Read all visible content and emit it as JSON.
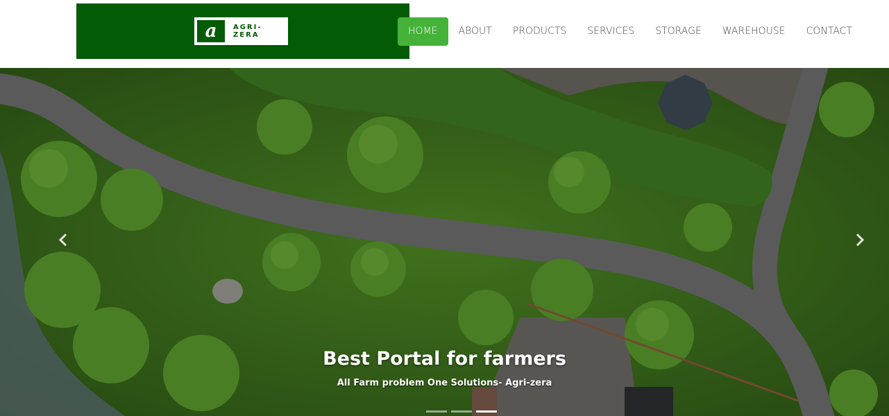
{
  "brand": {
    "logo_letter": "a",
    "logo_text": "AGRI-ZERA",
    "color": "#035c05"
  },
  "nav": {
    "items": [
      {
        "label": "HOME",
        "active": true
      },
      {
        "label": "ABOUT"
      },
      {
        "label": "PRODUCTS"
      },
      {
        "label": "SERVICES"
      },
      {
        "label": "STORAGE"
      },
      {
        "label": "WAREHOUSE"
      },
      {
        "label": "CONTACT"
      }
    ],
    "active_color": "#45b23a"
  },
  "carousel": {
    "title": "Best Portal for farmers",
    "subtitle": "All Farm problem One Solutions- Agri-zera",
    "prev_icon": "chevron-left-icon",
    "next_icon": "chevron-right-icon",
    "slide_count": 3,
    "active_slide": 3
  }
}
